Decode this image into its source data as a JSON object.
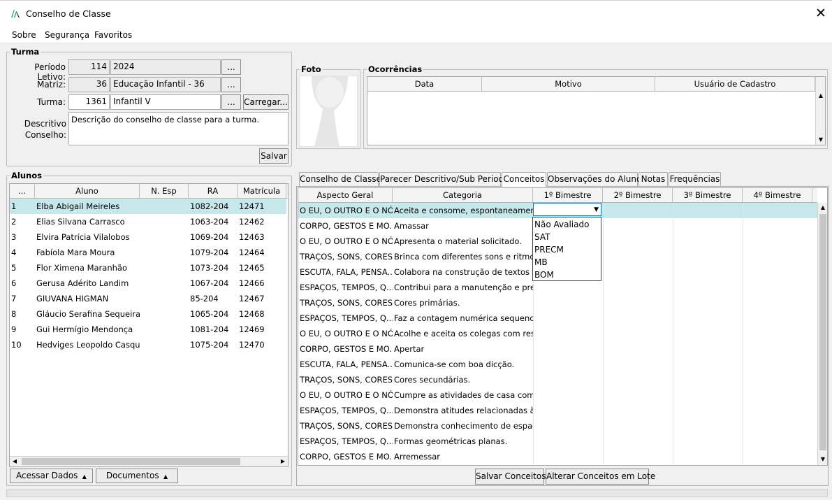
{
  "window": {
    "title": "Conselho de Classe",
    "close_glyph": "✕"
  },
  "menu": [
    "Sobre",
    "Segurança",
    "Favoritos"
  ],
  "turma": {
    "legend": "Turma",
    "periodo_label": "Período Letivo:",
    "periodo_code": "114",
    "periodo_value": "2024",
    "matriz_label": "Matriz:",
    "matriz_code": "36",
    "matriz_value": "Educação Infantil - 36",
    "turma_label": "Turma:",
    "turma_code": "1361",
    "turma_value": "Infantil V",
    "browse_label": "...",
    "carregar_label": "Carregar...",
    "descritivo_label_1": "Descritivo",
    "descritivo_label_2": "Conselho:",
    "descritivo_value": "Descrição do conselho de classe para a turma.",
    "salvar_label": "Salvar"
  },
  "foto": {
    "legend": "Foto"
  },
  "ocorrencias": {
    "legend": "Ocorrências",
    "columns": [
      "Data",
      "Motivo",
      "Usuário de Cadastro"
    ]
  },
  "alunos": {
    "legend": "Alunos",
    "columns": [
      "...",
      "Aluno",
      "N. Esp",
      "RA",
      "Matrícula"
    ],
    "rows": [
      {
        "n": "1",
        "nome": "Elba Abigail Meireles",
        "esp": "",
        "ra": "1082-204",
        "mat": "12471"
      },
      {
        "n": "2",
        "nome": "Elias Silvana Carrasco",
        "esp": "",
        "ra": "1063-204",
        "mat": "12462"
      },
      {
        "n": "3",
        "nome": "Elvira Patrícia Vilalobos",
        "esp": "",
        "ra": "1069-204",
        "mat": "12463"
      },
      {
        "n": "4",
        "nome": "Fabíola Mara Moura",
        "esp": "",
        "ra": "1079-204",
        "mat": "12464"
      },
      {
        "n": "5",
        "nome": "Flor Ximena Maranhão",
        "esp": "",
        "ra": "1073-204",
        "mat": "12465"
      },
      {
        "n": "6",
        "nome": "Gerusa Adérito Landim",
        "esp": "",
        "ra": "1067-204",
        "mat": "12466"
      },
      {
        "n": "7",
        "nome": "GIUVANA HIGMAN",
        "esp": "",
        "ra": "85-204",
        "mat": "12467"
      },
      {
        "n": "8",
        "nome": "Gláucio Serafina Sequeira",
        "esp": "",
        "ra": "1065-204",
        "mat": "12468"
      },
      {
        "n": "9",
        "nome": "Gui Hermígio Mendonça",
        "esp": "",
        "ra": "1081-204",
        "mat": "12469"
      },
      {
        "n": "10",
        "nome": "Hedviges Leopoldo Casqu...",
        "esp": "",
        "ra": "1075-204",
        "mat": "12470"
      }
    ],
    "acessar_label": "Acessar Dados",
    "documentos_label": "Documentos"
  },
  "tabs": [
    "Conselho de Classe",
    "Parecer Descritivo/Sub Periodo",
    "Conceitos",
    "Observações do Aluno",
    "Notas",
    "Frequências"
  ],
  "conceitos": {
    "columns": [
      "Aspecto Geral",
      "Categoria",
      "1º Bimestre",
      "2º Bimestre",
      "3º Bimestre",
      "4º Bimestre"
    ],
    "rows": [
      {
        "aspecto": "O EU, O OUTRO E O NÓS",
        "categoria": "Aceita e consome, espontaneament..."
      },
      {
        "aspecto": "CORPO, GESTOS E MO...",
        "categoria": "Amassar"
      },
      {
        "aspecto": "O EU, O OUTRO E O NÓS",
        "categoria": "Apresenta o material solicitado."
      },
      {
        "aspecto": "TRAÇOS, SONS, CORES...",
        "categoria": "Brinca com diferentes sons e ritmos..."
      },
      {
        "aspecto": "ESCUTA, FALA, PENSA...",
        "categoria": "Colabora na construção de textos c..."
      },
      {
        "aspecto": "ESPAÇOS, TEMPOS, Q...",
        "categoria": "Contribui para a manutenção e pres..."
      },
      {
        "aspecto": "TRAÇOS, SONS, CORES...",
        "categoria": "Cores primárias."
      },
      {
        "aspecto": "ESPAÇOS, TEMPOS, Q...",
        "categoria": "Faz a contagem numérica sequencial."
      },
      {
        "aspecto": "O EU, O OUTRO E O NÓS",
        "categoria": "Acolhe e aceita os colegas com res..."
      },
      {
        "aspecto": "CORPO, GESTOS E MO...",
        "categoria": "Apertar"
      },
      {
        "aspecto": "ESCUTA, FALA, PENSA...",
        "categoria": "Comunica-se com boa dicção."
      },
      {
        "aspecto": "TRAÇOS, SONS, CORES...",
        "categoria": "Cores secundárias."
      },
      {
        "aspecto": "O EU, O OUTRO E O NÓS",
        "categoria": "Cumpre as atividades de casa com r..."
      },
      {
        "aspecto": "ESPAÇOS, TEMPOS, Q...",
        "categoria": "Demonstra atitudes relacionadas à ..."
      },
      {
        "aspecto": "TRAÇOS, SONS, CORES...",
        "categoria": "Demonstra conhecimento de espaço."
      },
      {
        "aspecto": "ESPAÇOS, TEMPOS, Q...",
        "categoria": "Formas geométricas planas."
      },
      {
        "aspecto": "CORPO, GESTOS E MO...",
        "categoria": "Arremessar"
      }
    ],
    "dropdown_options": [
      "Não Avaliado",
      "SAT",
      "PRECM",
      "MB",
      "BOM"
    ],
    "salvar_label": "Salvar Conceitos",
    "alterar_label": "Alterar Conceitos em Lote"
  },
  "colors": {
    "selected_row": "#c7e8ea",
    "focus_border": "#0078d7"
  }
}
